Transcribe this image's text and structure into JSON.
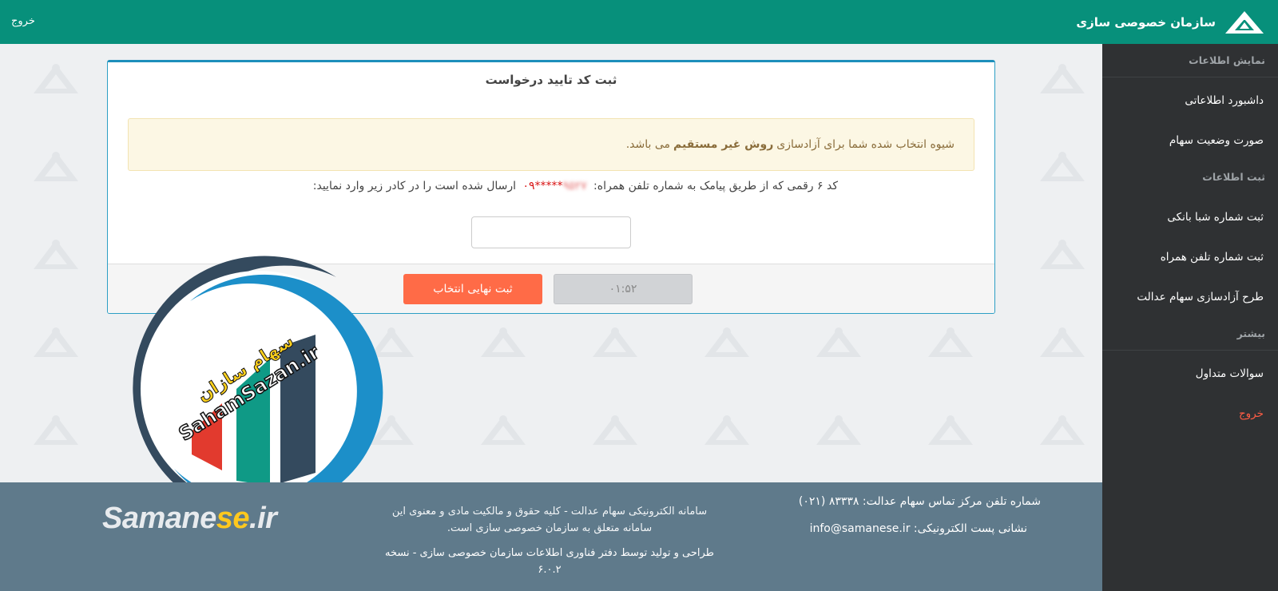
{
  "header": {
    "brand": "سازمان خصوصی سازی",
    "logout": "خروج",
    "color": "#07907b"
  },
  "sidebar": {
    "sections": [
      {
        "title": "نمایش اطلاعات",
        "items": [
          "داشبورد اطلاعاتی",
          "صورت وضعیت سهام"
        ]
      },
      {
        "title": "ثبت اطلاعات",
        "items": [
          "ثبت شماره شبا بانکی",
          "ثبت شماره تلفن همراه",
          "طرح آزادسازی سهام عدالت"
        ]
      },
      {
        "title": "بیشتر",
        "items": [
          "سوالات متداول",
          "خروج"
        ]
      }
    ]
  },
  "panel": {
    "title": "ثبت کد تایید درخواست",
    "alert_prefix": "شیوه انتخاب شده شما برای آزادسازی",
    "alert_strong": "روش غیر مستقیم",
    "alert_suffix": "می باشد.",
    "sms_prefix": "کد ۶ رقمی که از طریق پیامک به شماره تلفن همراه:",
    "phone_visible": "۰۹*****",
    "phone_hidden": "۹۵۲۷",
    "sms_suffix": "ارسال شده است را در کادر زیر وارد نمایید:",
    "code_value": "",
    "submit_label": "ثبت نهایی انتخاب",
    "timer": "۰۱:۵۲"
  },
  "watermark": {
    "name": "سهام سازان",
    "site": "SahamSazan.ir"
  },
  "footer": {
    "logo_a": "Samane",
    "logo_b": "se",
    "logo_c": ".ir",
    "copyright": "سامانه الکترونیکی سهام عدالت - کلیه حقوق و مالکیت مادی و معنوی این سامانه متعلق به سازمان خصوصی سازی است.",
    "credit": "طراحی و تولید توسط دفتر فناوری اطلاعات سازمان خصوصی سازی - نسخه ۶.۰.۲",
    "phone_label": "شماره تلفن مرکز تماس سهام عدالت: ۸۳۳۳۸ (۰۲۱)",
    "email_label": "نشانی پست الکترونیکی: info@samanese.ir"
  },
  "colors": {
    "accent": "#07907b",
    "sidebar": "#2f3133",
    "submit": "#ff6b47",
    "footer": "#5f7a8b"
  }
}
